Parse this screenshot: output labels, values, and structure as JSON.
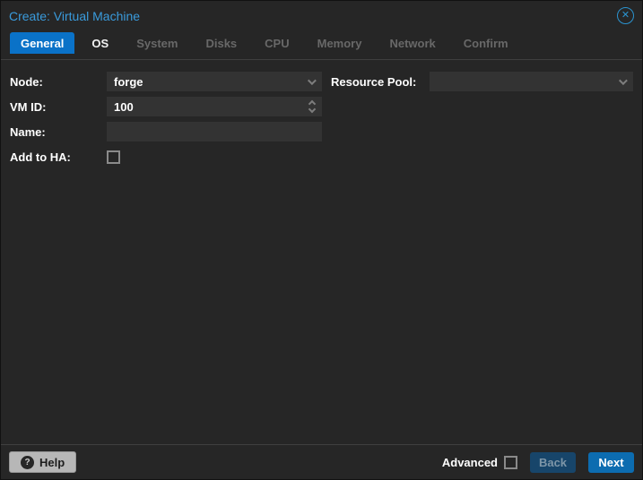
{
  "window": {
    "title": "Create: Virtual Machine",
    "close_icon": "circle-x-icon"
  },
  "tabs": [
    {
      "label": "General",
      "state": "active"
    },
    {
      "label": "OS",
      "state": "enabled"
    },
    {
      "label": "System",
      "state": "disabled"
    },
    {
      "label": "Disks",
      "state": "disabled"
    },
    {
      "label": "CPU",
      "state": "disabled"
    },
    {
      "label": "Memory",
      "state": "disabled"
    },
    {
      "label": "Network",
      "state": "disabled"
    },
    {
      "label": "Confirm",
      "state": "disabled"
    }
  ],
  "form": {
    "left": [
      {
        "label": "Node:",
        "type": "combobox",
        "value": "forge"
      },
      {
        "label": "VM ID:",
        "type": "spinner",
        "value": "100"
      },
      {
        "label": "Name:",
        "type": "text",
        "value": "",
        "placeholder": ""
      },
      {
        "label": "Add to HA:",
        "type": "checkbox",
        "checked": false
      }
    ],
    "right": [
      {
        "label": "Resource Pool:",
        "type": "combobox",
        "value": ""
      }
    ]
  },
  "footer": {
    "help_label": "Help",
    "help_icon": "question-circle-icon",
    "advanced_label": "Advanced",
    "advanced_checked": false,
    "back_label": "Back",
    "back_enabled": false,
    "next_label": "Next",
    "next_enabled": true
  },
  "colors": {
    "dialog_bg": "#262626",
    "title_text": "#3a9bdc",
    "tab_active_bg": "#0a72c8",
    "tab_disabled_text": "#686868",
    "separator": "#3f3f3f",
    "field_bg": "#333333",
    "next_button_bg": "#0c6cb0",
    "back_button_bg": "#17456a",
    "help_button_bg": "#b7b7b7",
    "close_icon": "#2b93cf"
  }
}
